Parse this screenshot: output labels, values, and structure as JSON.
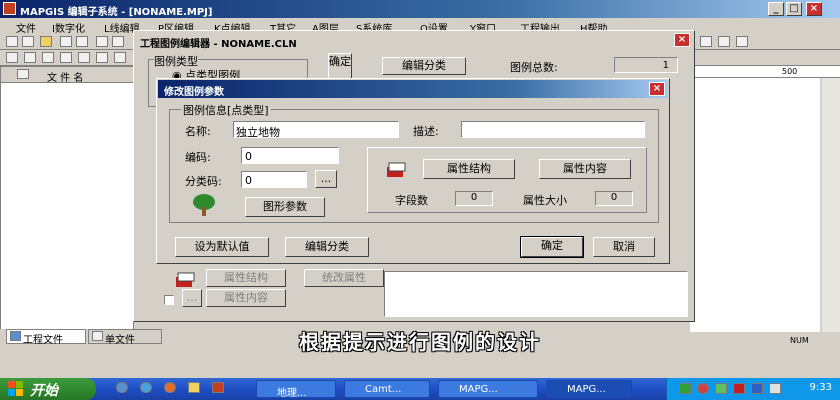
{
  "app": {
    "title": "MAPGIS 编辑子系统 - [NONAME.MPJ]",
    "menus": [
      "文件",
      "I数字化",
      "L线编辑",
      "P区编辑",
      "K点编辑",
      "T其它",
      "A图层",
      "S系统库",
      "O设置",
      "Y窗口",
      "工程输出",
      "H帮助"
    ]
  },
  "left_panel": {
    "column_header": "文  件  名",
    "tabs": [
      "工程文件",
      "单文件"
    ]
  },
  "ruler": {
    "mark": "500"
  },
  "status": {
    "num": "NUM"
  },
  "legend_editor": {
    "title": "工程图例编辑器 - NONAME.CLN",
    "type_group_label": "图例类型",
    "type_option": "点类型图例",
    "ok_button_short": "确定",
    "edit_category_button": "编辑分类",
    "total_label": "图例总数:",
    "total_value": "1",
    "behind_attr_struct": "属性结构",
    "behind_attr_content": "属性内容",
    "behind_unify": "统改属性"
  },
  "dialog": {
    "title": "修改图例参数",
    "group_label": "图例信息[点类型]",
    "name_label": "名称:",
    "name_value": "独立地物",
    "desc_label": "描述:",
    "desc_value": "",
    "code_label": "编码:",
    "code_value": "0",
    "category_label": "分类码:",
    "category_value": "0",
    "browse_button": "...",
    "graphic_params_button": "图形参数",
    "attr_struct_button": "属性结构",
    "attr_content_button": "属性内容",
    "field_count_label": "字段数",
    "field_count_value": "0",
    "attr_size_label": "属性大小",
    "attr_size_value": "0",
    "set_default_button": "设为默认值",
    "edit_category_button": "编辑分类",
    "ok_button": "确定",
    "cancel_button": "取消"
  },
  "subtitle": "根据提示进行图例的设计",
  "taskbar": {
    "start": "开始",
    "tasks": [
      "地理...",
      "Camt...",
      "MAPG...",
      "MAPG..."
    ],
    "clock": "9:33"
  }
}
